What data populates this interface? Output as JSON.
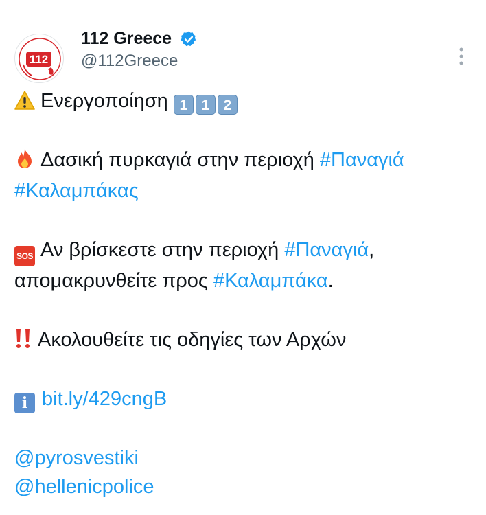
{
  "account": {
    "avatar_text": "112",
    "display_name": "112 Greece",
    "handle": "@112Greece"
  },
  "tweet": {
    "line1": {
      "emoji": "warning-icon",
      "text": "Ενεργοποίηση",
      "keycaps": [
        "1",
        "1",
        "2"
      ]
    },
    "line2": {
      "emoji": "fire-icon",
      "text": "Δασική πυρκαγιά στην περιοχή ",
      "hashtag": "#Παναγιά"
    },
    "line3": {
      "hashtag": "#Καλαμπάκας"
    },
    "line4": {
      "emoji_text": "SOS",
      "text": "Αν βρίσκεστε στην περιοχή ",
      "hashtag": "#Παναγιά",
      "suffix": ","
    },
    "line5": {
      "text": "απομακρυνθείτε προς ",
      "hashtag": "#Καλαμπάκα",
      "suffix": "."
    },
    "line6": {
      "emoji": "double-exclamation-icon",
      "text": "Ακολουθείτε τις οδηγίες των Αρχών"
    },
    "line7": {
      "emoji_text": "i",
      "link": "bit.ly/429cngB"
    },
    "mention1": "@pyrosvestiki",
    "mention2": "@hellenicpolice"
  },
  "colors": {
    "link": "#1d9bf0",
    "text": "#0f1419",
    "secondary": "#536471",
    "verified": "#1d9bf0",
    "avatar_red": "#d7262b"
  }
}
